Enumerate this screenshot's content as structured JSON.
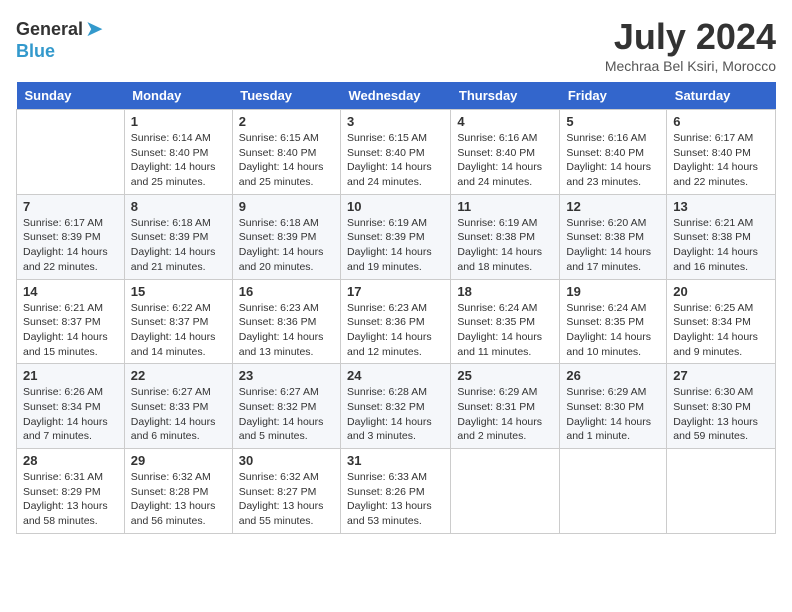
{
  "header": {
    "logo_general": "General",
    "logo_blue": "Blue",
    "title": "July 2024",
    "subtitle": "Mechraa Bel Ksiri, Morocco"
  },
  "days_of_week": [
    "Sunday",
    "Monday",
    "Tuesday",
    "Wednesday",
    "Thursday",
    "Friday",
    "Saturday"
  ],
  "weeks": [
    [
      {
        "day": "",
        "info": ""
      },
      {
        "day": "1",
        "info": "Sunrise: 6:14 AM\nSunset: 8:40 PM\nDaylight: 14 hours and 25 minutes."
      },
      {
        "day": "2",
        "info": "Sunrise: 6:15 AM\nSunset: 8:40 PM\nDaylight: 14 hours and 25 minutes."
      },
      {
        "day": "3",
        "info": "Sunrise: 6:15 AM\nSunset: 8:40 PM\nDaylight: 14 hours and 24 minutes."
      },
      {
        "day": "4",
        "info": "Sunrise: 6:16 AM\nSunset: 8:40 PM\nDaylight: 14 hours and 24 minutes."
      },
      {
        "day": "5",
        "info": "Sunrise: 6:16 AM\nSunset: 8:40 PM\nDaylight: 14 hours and 23 minutes."
      },
      {
        "day": "6",
        "info": "Sunrise: 6:17 AM\nSunset: 8:40 PM\nDaylight: 14 hours and 22 minutes."
      }
    ],
    [
      {
        "day": "7",
        "info": "Sunrise: 6:17 AM\nSunset: 8:39 PM\nDaylight: 14 hours and 22 minutes."
      },
      {
        "day": "8",
        "info": "Sunrise: 6:18 AM\nSunset: 8:39 PM\nDaylight: 14 hours and 21 minutes."
      },
      {
        "day": "9",
        "info": "Sunrise: 6:18 AM\nSunset: 8:39 PM\nDaylight: 14 hours and 20 minutes."
      },
      {
        "day": "10",
        "info": "Sunrise: 6:19 AM\nSunset: 8:39 PM\nDaylight: 14 hours and 19 minutes."
      },
      {
        "day": "11",
        "info": "Sunrise: 6:19 AM\nSunset: 8:38 PM\nDaylight: 14 hours and 18 minutes."
      },
      {
        "day": "12",
        "info": "Sunrise: 6:20 AM\nSunset: 8:38 PM\nDaylight: 14 hours and 17 minutes."
      },
      {
        "day": "13",
        "info": "Sunrise: 6:21 AM\nSunset: 8:38 PM\nDaylight: 14 hours and 16 minutes."
      }
    ],
    [
      {
        "day": "14",
        "info": "Sunrise: 6:21 AM\nSunset: 8:37 PM\nDaylight: 14 hours and 15 minutes."
      },
      {
        "day": "15",
        "info": "Sunrise: 6:22 AM\nSunset: 8:37 PM\nDaylight: 14 hours and 14 minutes."
      },
      {
        "day": "16",
        "info": "Sunrise: 6:23 AM\nSunset: 8:36 PM\nDaylight: 14 hours and 13 minutes."
      },
      {
        "day": "17",
        "info": "Sunrise: 6:23 AM\nSunset: 8:36 PM\nDaylight: 14 hours and 12 minutes."
      },
      {
        "day": "18",
        "info": "Sunrise: 6:24 AM\nSunset: 8:35 PM\nDaylight: 14 hours and 11 minutes."
      },
      {
        "day": "19",
        "info": "Sunrise: 6:24 AM\nSunset: 8:35 PM\nDaylight: 14 hours and 10 minutes."
      },
      {
        "day": "20",
        "info": "Sunrise: 6:25 AM\nSunset: 8:34 PM\nDaylight: 14 hours and 9 minutes."
      }
    ],
    [
      {
        "day": "21",
        "info": "Sunrise: 6:26 AM\nSunset: 8:34 PM\nDaylight: 14 hours and 7 minutes."
      },
      {
        "day": "22",
        "info": "Sunrise: 6:27 AM\nSunset: 8:33 PM\nDaylight: 14 hours and 6 minutes."
      },
      {
        "day": "23",
        "info": "Sunrise: 6:27 AM\nSunset: 8:32 PM\nDaylight: 14 hours and 5 minutes."
      },
      {
        "day": "24",
        "info": "Sunrise: 6:28 AM\nSunset: 8:32 PM\nDaylight: 14 hours and 3 minutes."
      },
      {
        "day": "25",
        "info": "Sunrise: 6:29 AM\nSunset: 8:31 PM\nDaylight: 14 hours and 2 minutes."
      },
      {
        "day": "26",
        "info": "Sunrise: 6:29 AM\nSunset: 8:30 PM\nDaylight: 14 hours and 1 minute."
      },
      {
        "day": "27",
        "info": "Sunrise: 6:30 AM\nSunset: 8:30 PM\nDaylight: 13 hours and 59 minutes."
      }
    ],
    [
      {
        "day": "28",
        "info": "Sunrise: 6:31 AM\nSunset: 8:29 PM\nDaylight: 13 hours and 58 minutes."
      },
      {
        "day": "29",
        "info": "Sunrise: 6:32 AM\nSunset: 8:28 PM\nDaylight: 13 hours and 56 minutes."
      },
      {
        "day": "30",
        "info": "Sunrise: 6:32 AM\nSunset: 8:27 PM\nDaylight: 13 hours and 55 minutes."
      },
      {
        "day": "31",
        "info": "Sunrise: 6:33 AM\nSunset: 8:26 PM\nDaylight: 13 hours and 53 minutes."
      },
      {
        "day": "",
        "info": ""
      },
      {
        "day": "",
        "info": ""
      },
      {
        "day": "",
        "info": ""
      }
    ]
  ]
}
